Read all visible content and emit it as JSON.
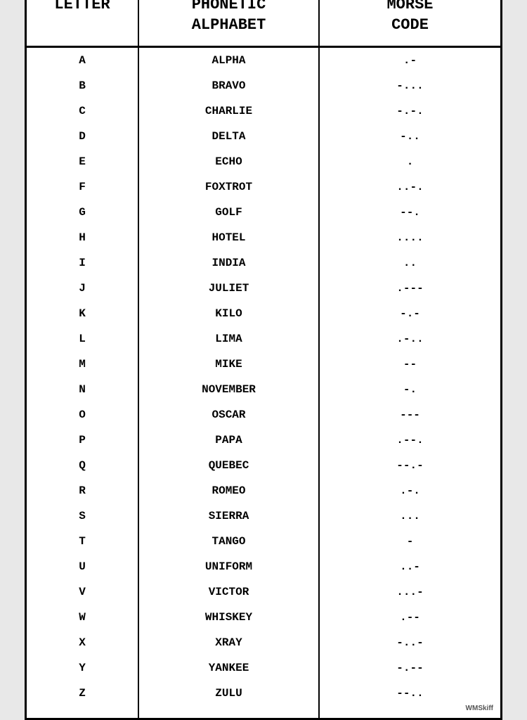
{
  "header": {
    "col1": "LETTER",
    "col2": "PHONETIC\nALPHABET",
    "col3": "MORSE\nCODE"
  },
  "rows": [
    {
      "letter": "A",
      "phonetic": "ALPHA",
      "morse": ".-"
    },
    {
      "letter": "B",
      "phonetic": "BRAVO",
      "morse": "-..."
    },
    {
      "letter": "C",
      "phonetic": "CHARLIE",
      "morse": "-.-."
    },
    {
      "letter": "D",
      "phonetic": "DELTA",
      "morse": "-.."
    },
    {
      "letter": "E",
      "phonetic": "ECHO",
      "morse": "."
    },
    {
      "letter": "F",
      "phonetic": "FOXTROT",
      "morse": "..-."
    },
    {
      "letter": "G",
      "phonetic": "GOLF",
      "morse": "--."
    },
    {
      "letter": "H",
      "phonetic": "HOTEL",
      "morse": "...."
    },
    {
      "letter": "I",
      "phonetic": "INDIA",
      "morse": ".."
    },
    {
      "letter": "J",
      "phonetic": "JULIET",
      "morse": ".---"
    },
    {
      "letter": "K",
      "phonetic": "KILO",
      "morse": "-.-"
    },
    {
      "letter": "L",
      "phonetic": "LIMA",
      "morse": ".-.."
    },
    {
      "letter": "M",
      "phonetic": "MIKE",
      "morse": "--"
    },
    {
      "letter": "N",
      "phonetic": "NOVEMBER",
      "morse": "-."
    },
    {
      "letter": "O",
      "phonetic": "OSCAR",
      "morse": "---"
    },
    {
      "letter": "P",
      "phonetic": "PAPA",
      "morse": ".--."
    },
    {
      "letter": "Q",
      "phonetic": "QUEBEC",
      "morse": "--.-"
    },
    {
      "letter": "R",
      "phonetic": "ROMEO",
      "morse": ".-."
    },
    {
      "letter": "S",
      "phonetic": "SIERRA",
      "morse": "..."
    },
    {
      "letter": "T",
      "phonetic": "TANGO",
      "morse": "-"
    },
    {
      "letter": "U",
      "phonetic": "UNIFORM",
      "morse": "..-"
    },
    {
      "letter": "V",
      "phonetic": "VICTOR",
      "morse": "...-"
    },
    {
      "letter": "W",
      "phonetic": "WHISKEY",
      "morse": ".--"
    },
    {
      "letter": "X",
      "phonetic": "XRAY",
      "morse": "-..-"
    },
    {
      "letter": "Y",
      "phonetic": "YANKEE",
      "morse": "-.--"
    },
    {
      "letter": "Z",
      "phonetic": "ZULU",
      "morse": "--.."
    }
  ],
  "watermark": "WMSkiff"
}
